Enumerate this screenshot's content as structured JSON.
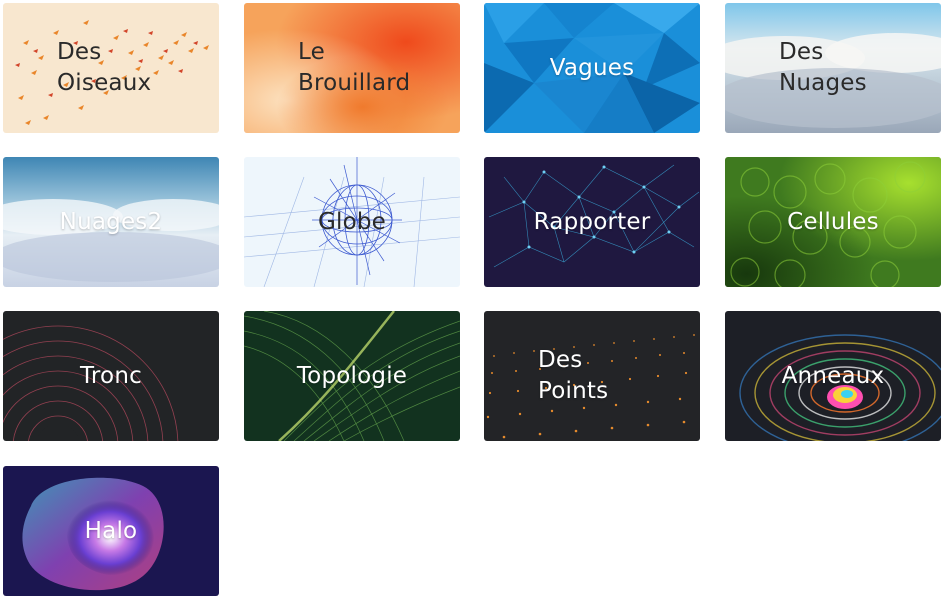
{
  "cards": [
    {
      "id": "oiseaux",
      "lines": [
        "Des",
        "Oiseaux"
      ]
    },
    {
      "id": "brouillard",
      "lines": [
        "Le",
        "Brouillard"
      ]
    },
    {
      "id": "vagues",
      "lines": [
        "Vagues"
      ]
    },
    {
      "id": "nuages",
      "lines": [
        "Des",
        "Nuages"
      ]
    },
    {
      "id": "nuages2",
      "lines": [
        "Nuages2"
      ]
    },
    {
      "id": "globe",
      "lines": [
        "Globe"
      ]
    },
    {
      "id": "rapporter",
      "lines": [
        "Rapporter"
      ]
    },
    {
      "id": "cellules",
      "lines": [
        "Cellules"
      ]
    },
    {
      "id": "tronc",
      "lines": [
        "Tronc"
      ]
    },
    {
      "id": "topologie",
      "lines": [
        "Topologie"
      ]
    },
    {
      "id": "points",
      "lines": [
        "Des",
        "Points"
      ]
    },
    {
      "id": "anneaux",
      "lines": [
        "Anneaux"
      ]
    },
    {
      "id": "halo",
      "lines": [
        "Halo"
      ]
    }
  ],
  "colors": {
    "oiseaux_bg": "#f8e7cf",
    "brouillard_bg": "#f6a35b",
    "vagues_bg": "#1a8fd9",
    "nuages_bg": "#c9d7e6",
    "nuages2_bg": "#5f9ec4",
    "globe_bg": "#eef6fc",
    "rapporter_bg": "#1f1840",
    "cellules_bg": "#3f7a1f",
    "tronc_bg": "#222426",
    "topologie_bg": "#12321f",
    "points_bg": "#232427",
    "anneaux_bg": "#1d1f26",
    "halo_bg": "#1b1650"
  }
}
